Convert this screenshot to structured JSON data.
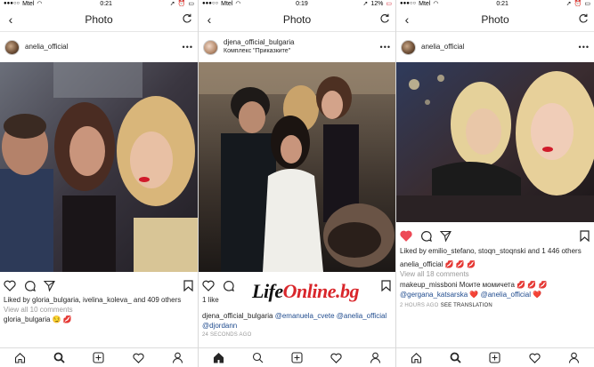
{
  "panels": [
    {
      "status": {
        "carrier": "Mtel",
        "time": "0:21",
        "battery": ""
      },
      "nav": {
        "title": "Photo"
      },
      "post": {
        "username": "anelia_official",
        "location": "",
        "liked_by": "Liked by gloria_bulgaria, ivelina_koleva_ and 409 others",
        "view_comments": "View all 10 comments",
        "comments": [
          {
            "user": "gloria_bulgaria",
            "text": "😏 💋"
          }
        ],
        "timestamp": ""
      }
    },
    {
      "status": {
        "carrier": "Mtel",
        "time": "0:19",
        "battery": "12%"
      },
      "nav": {
        "title": "Photo"
      },
      "post": {
        "username": "djena_official_bulgaria",
        "location": "Комплекс \"Приказките\"",
        "likes": "1 like",
        "caption_user": "djena_official_bulgaria",
        "caption_mentions": "@emanuela_cvete @anelia_official @djordann",
        "timestamp": "24 SECONDS AGO"
      }
    },
    {
      "status": {
        "carrier": "Mtel",
        "time": "0:21",
        "battery": ""
      },
      "nav": {
        "title": "Photo"
      },
      "post": {
        "username": "anelia_official",
        "location": "",
        "liked_by": "Liked by emilio_stefano, stoqn_stoqnski and 1 446 others",
        "caption_user": "anelia_official",
        "caption_text": "💋 💋 💋",
        "view_comments": "View all 18 comments",
        "comment_user": "makeup_missboni",
        "comment_text": "Моите момичета 💋 💋 💋",
        "comment_mentions": "@gergana_katsarska ❤️ @anelia_official ❤️",
        "timestamp": "2 HOURS AGO",
        "see_translation": "SEE TRANSLATION"
      }
    }
  ],
  "watermark": {
    "prefix": "Life",
    "suffix": "Online.bg"
  },
  "colors": {
    "heart_active": "#ed4956",
    "link": "#1f4b8e",
    "muted": "#999999"
  }
}
